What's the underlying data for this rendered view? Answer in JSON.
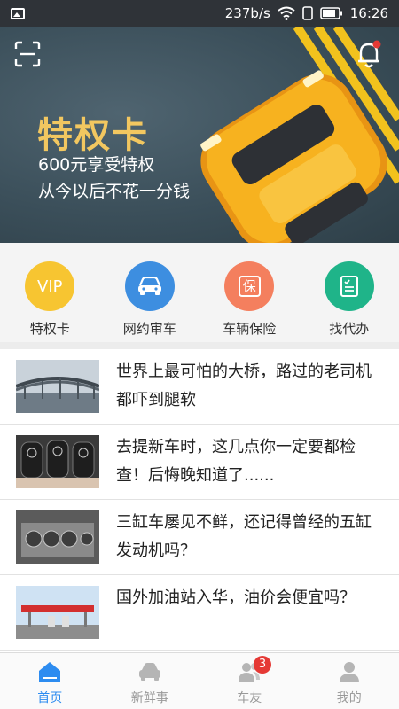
{
  "status_bar": {
    "speed": "237b/s",
    "time": "16:26"
  },
  "banner": {
    "title": "特权卡",
    "subtitle1": "600元享受特权",
    "subtitle2": "从今以后不花一分钱",
    "page_index": 1,
    "page_count": 2
  },
  "shortcuts": [
    {
      "label": "特权卡",
      "icon_text": "VIP",
      "color": "#f7c531",
      "icon": "vip-icon"
    },
    {
      "label": "网约审车",
      "color": "#3d8ee0",
      "icon": "car-icon"
    },
    {
      "label": "车辆保险",
      "icon_text": "保",
      "color": "#f47f5e",
      "icon": "insurance-icon"
    },
    {
      "label": "找代办",
      "color": "#1fb489",
      "icon": "document-icon"
    }
  ],
  "news": [
    {
      "title": "世界上最可怕的大桥，路过的老司机都吓到腿软",
      "thumb": "bridge"
    },
    {
      "title": "去提新车时，这几点你一定要都检查！后悔晚知道了......",
      "thumb": "car-keys"
    },
    {
      "title": "三缸车屡见不鲜，还记得曾经的五缸发动机吗？",
      "thumb": "engine"
    },
    {
      "title": "国外加油站入华，油价会便宜吗？",
      "thumb": "gas-station"
    }
  ],
  "tabs": [
    {
      "label": "首页",
      "active": true
    },
    {
      "label": "新鲜事",
      "active": false
    },
    {
      "label": "车友",
      "active": false,
      "badge": "3"
    },
    {
      "label": "我的",
      "active": false
    }
  ],
  "colors": {
    "accent": "#2d8cf0",
    "banner_title": "#f2c760",
    "badge": "#e53935"
  }
}
